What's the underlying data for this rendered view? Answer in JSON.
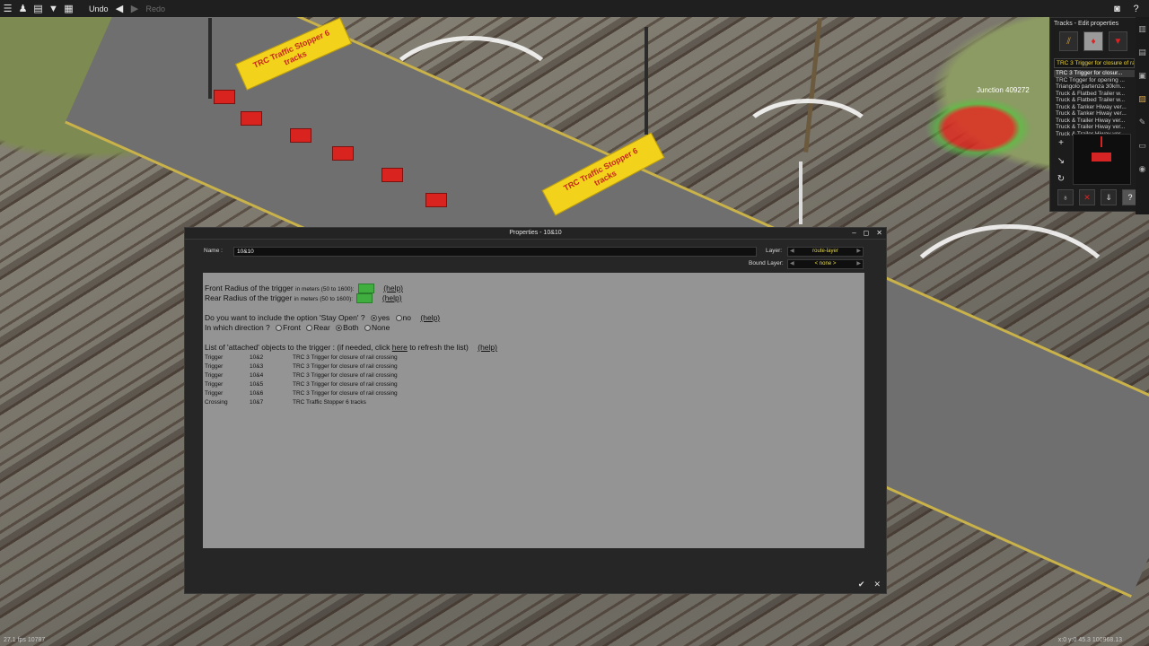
{
  "toolbar": {
    "icons": [
      "menu-icon",
      "pawn-icon",
      "book-icon",
      "filter-icon",
      "grid-icon"
    ],
    "undo_label": "Undo",
    "redo_label": "Redo",
    "right_icons": [
      "camera-icon",
      "help-icon"
    ]
  },
  "scene": {
    "junction_label": "Junction 409272",
    "sign1_text": "TRC Traffic Stopper 6 tracks",
    "sign2_text": "TRC Traffic Stopper 6 tracks"
  },
  "edit_panel": {
    "title": "Tracks - Edit properties",
    "selected": "TRC 3 Trigger for closure of rai",
    "items": [
      "TRC 3 Trigger for closur...",
      "TRC Trigger for opening ...",
      "Triangolo partenza 30km...",
      "Truck & Flatbed Trailer w...",
      "Truck & Flatbed Trailer w...",
      "Truck & Tanker Hiway ver...",
      "Truck & Tanker Hiway ver...",
      "Truck & Trailer Hiway ver...",
      "Truck & Trailer Hiway ver...",
      "Truck & Trailer Hiway ver..."
    ]
  },
  "dialog": {
    "title": "Properties - 10&10",
    "name_label": "Name :",
    "name_value": "10&10",
    "layer_label": "Layer:",
    "layer_value": "route-layer",
    "bound_label": "Bound Layer:",
    "bound_value": "< none >",
    "front_radius_label": "Front Radius of the trigger",
    "rear_radius_label": "Rear Radius of the trigger",
    "radius_hint": "in meters (50 to 1600):",
    "help": "(help)",
    "stay_open_question": "Do you want to include the option 'Stay Open' ?",
    "yes": "yes",
    "no": "no",
    "direction_question": "In which direction ?",
    "front": "Front",
    "rear": "Rear",
    "both": "Both",
    "none": "None",
    "attached_prefix": "List of 'attached' objects to the trigger : (if needed, click",
    "attached_here": "here",
    "attached_suffix": "to refresh the list)",
    "objects": [
      {
        "type": "Trigger",
        "id": "10&2",
        "name": "TRC 3 Trigger for closure of rail crossing"
      },
      {
        "type": "Trigger",
        "id": "10&3",
        "name": "TRC 3 Trigger for closure of rail crossing"
      },
      {
        "type": "Trigger",
        "id": "10&4",
        "name": "TRC 3 Trigger for closure of rail crossing"
      },
      {
        "type": "Trigger",
        "id": "10&5",
        "name": "TRC 3 Trigger for closure of rail crossing"
      },
      {
        "type": "Trigger",
        "id": "10&6",
        "name": "TRC 3 Trigger for closure of rail crossing"
      },
      {
        "type": "Crossing",
        "id": "10&7",
        "name": "TRC Traffic Stopper 6 tracks"
      }
    ]
  },
  "status": {
    "left": "27.1 fps  10787",
    "right": "x:0 y:0 45.3  100968.13"
  }
}
